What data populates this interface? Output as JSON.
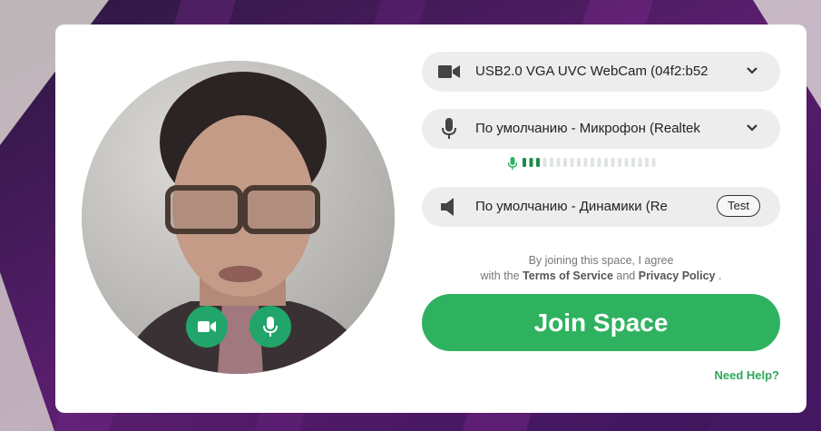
{
  "colors": {
    "accent": "#2fb25f",
    "icon_button": "#21a56a",
    "background": "#3a1650",
    "field": "#ededed"
  },
  "devices": {
    "camera": {
      "icon": "camera-icon",
      "value": "USB2.0 VGA UVC WebCam (04f2:b52"
    },
    "microphone": {
      "icon": "microphone-icon",
      "value": "По умолчанию - Микрофон (Realtek"
    },
    "speaker": {
      "icon": "speaker-icon",
      "value": "По умолчанию - Динамики (Re",
      "test_label": "Test"
    }
  },
  "mic_level": {
    "segments_total": 20,
    "segments_active": 3
  },
  "preview": {
    "camera_toggle_icon": "video-camera-icon",
    "mic_toggle_icon": "microphone-icon"
  },
  "agreement": {
    "line1": "By joining this space, I agree",
    "line2_prefix": "with the",
    "terms": "Terms of Service",
    "and": "and",
    "privacy": "Privacy Policy",
    "end": "."
  },
  "join_label": "Join Space",
  "help_label": "Need Help?"
}
